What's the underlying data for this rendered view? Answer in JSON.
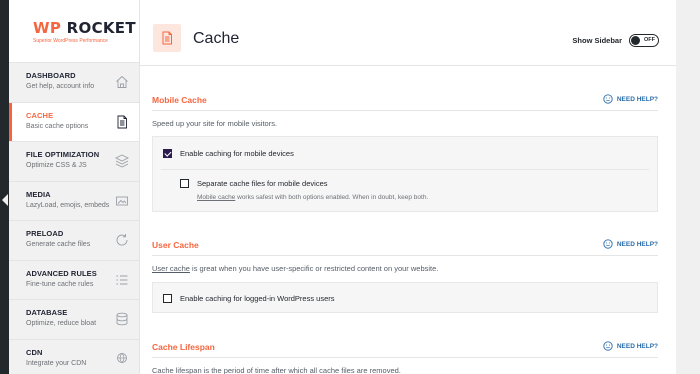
{
  "brand": {
    "wp": "WP",
    "rocket": "ROCKET",
    "tagline": "Superior WordPress Performance"
  },
  "sidebar": {
    "items": [
      {
        "title": "DASHBOARD",
        "sub": "Get help, account info",
        "icon": "home-icon"
      },
      {
        "title": "CACHE",
        "sub": "Basic cache options",
        "icon": "document-icon"
      },
      {
        "title": "FILE OPTIMIZATION",
        "sub": "Optimize CSS & JS",
        "icon": "layers-icon"
      },
      {
        "title": "MEDIA",
        "sub": "LazyLoad, emojis, embeds",
        "icon": "image-icon"
      },
      {
        "title": "PRELOAD",
        "sub": "Generate cache files",
        "icon": "refresh-icon"
      },
      {
        "title": "ADVANCED RULES",
        "sub": "Fine-tune cache rules",
        "icon": "list-icon"
      },
      {
        "title": "DATABASE",
        "sub": "Optimize, reduce bloat",
        "icon": "database-icon"
      },
      {
        "title": "CDN",
        "sub": "Integrate your CDN",
        "icon": "cdn-icon"
      }
    ]
  },
  "header": {
    "title": "Cache",
    "show_sidebar_label": "Show Sidebar",
    "toggle_text": "OFF"
  },
  "sections": {
    "mobile": {
      "title": "Mobile Cache",
      "help": "NEED HELP?",
      "description": "Speed up your site for mobile visitors.",
      "opt1_label": "Enable caching for mobile devices",
      "opt1_checked": true,
      "opt2_label": "Separate cache files for mobile devices",
      "opt2_checked": false,
      "note_link": "Mobile cache",
      "note_rest": " works safest with both options enabled. When in doubt, keep both."
    },
    "user": {
      "title": "User Cache",
      "help": "NEED HELP?",
      "desc_link": "User cache",
      "desc_rest": " is great when you have user-specific or restricted content on your website.",
      "opt1_label": "Enable caching for logged-in WordPress users",
      "opt1_checked": false
    },
    "lifespan": {
      "title": "Cache Lifespan",
      "help": "NEED HELP?",
      "description": "Cache lifespan is the period of time after which all cache files are removed."
    }
  },
  "colors": {
    "accent": "#f56640",
    "link": "#2a6cab",
    "dark": "#1f2332"
  }
}
